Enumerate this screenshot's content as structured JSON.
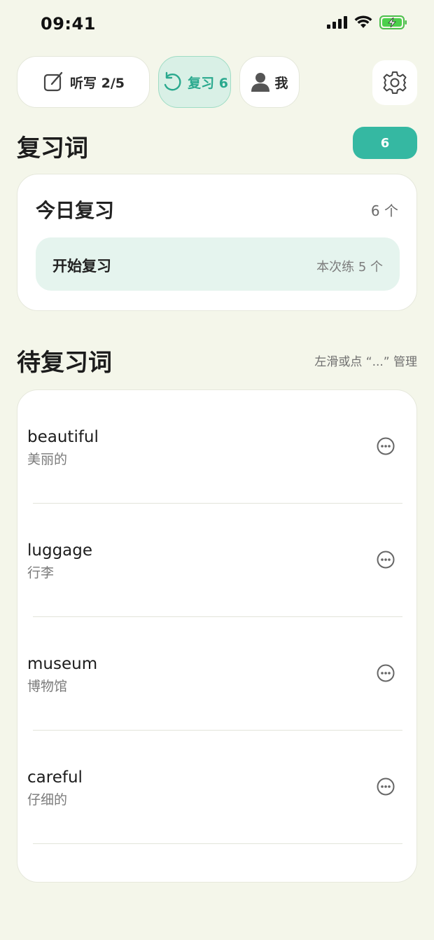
{
  "status_bar": {
    "time": "09:41"
  },
  "tabs": {
    "dictation": {
      "label": "听写 2/5",
      "icon": "edit-icon"
    },
    "review": {
      "label": "复习 6",
      "icon": "refresh-icon",
      "active": true
    },
    "me": {
      "label": "我",
      "icon": "user-icon"
    },
    "settings": {
      "icon": "gear-icon"
    }
  },
  "review_section": {
    "title": "复习词",
    "count": "6"
  },
  "today": {
    "title": "今日复习",
    "count": "6 个",
    "start_label": "开始复习",
    "start_sub": "本次练 5 个"
  },
  "pending": {
    "title": "待复习词",
    "hint": "左滑或点 “...” 管理",
    "words": [
      {
        "en": "beautiful",
        "zh": "美丽的"
      },
      {
        "en": "luggage",
        "zh": "行李"
      },
      {
        "en": "museum",
        "zh": "博物馆"
      },
      {
        "en": "careful",
        "zh": "仔细的"
      }
    ]
  },
  "colors": {
    "accent": "#35b8a2",
    "background": "#f4f6ea",
    "active_tab": "#d9f0e6"
  }
}
